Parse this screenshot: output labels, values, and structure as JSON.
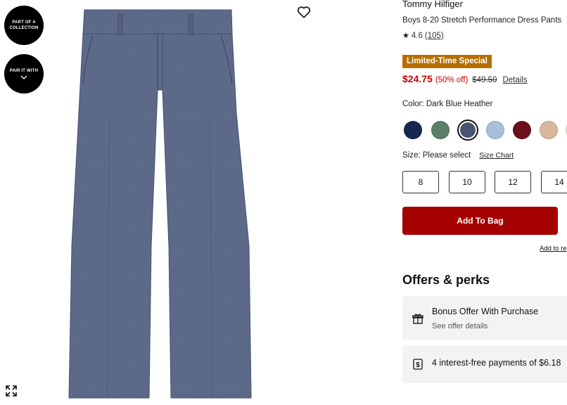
{
  "badges": {
    "collection_text": "PART OF A COLLECTION",
    "pair_text": "PAIR IT WITH"
  },
  "product": {
    "brand": "Tommy Hilfiger",
    "title": "Boys 8-20 Stretch Performance Dress Pants",
    "rating": "4.6",
    "review_count": "(105)",
    "image_icon": "dress-pants-image"
  },
  "promo": {
    "label": "Limited-Time Special",
    "color": "#b76e00"
  },
  "price": {
    "current": "$24.75",
    "percent_off": "(50% off)",
    "original": "$49.50",
    "details_link": "Details",
    "sale_color": "#cc0000"
  },
  "color": {
    "label": "Color: Dark Blue Heather",
    "swatches": [
      {
        "name": "navy",
        "hex": "#16284f"
      },
      {
        "name": "green",
        "hex": "#5c7d66"
      },
      {
        "name": "dark-blue-heather",
        "hex": "#4a5570",
        "selected": true
      },
      {
        "name": "light-blue",
        "hex": "#a9bed9"
      },
      {
        "name": "burgundy",
        "hex": "#6b0f1c"
      },
      {
        "name": "tan",
        "hex": "#d8b89c"
      },
      {
        "name": "partial",
        "hex": "#e6e0d8"
      }
    ]
  },
  "size": {
    "label": "Size: Please select",
    "chart_link": "Size Chart",
    "options": [
      "8",
      "10",
      "12",
      "14"
    ]
  },
  "actions": {
    "add_to_bag": "Add To Bag",
    "add_to_registry": "Add to re",
    "button_color": "#a50000"
  },
  "offers": {
    "heading": "Offers & perks",
    "bonus_title": "Bonus Offer With Purchase",
    "bonus_sub": "See offer details",
    "payments_title": "4 interest-free payments of $6.18"
  }
}
